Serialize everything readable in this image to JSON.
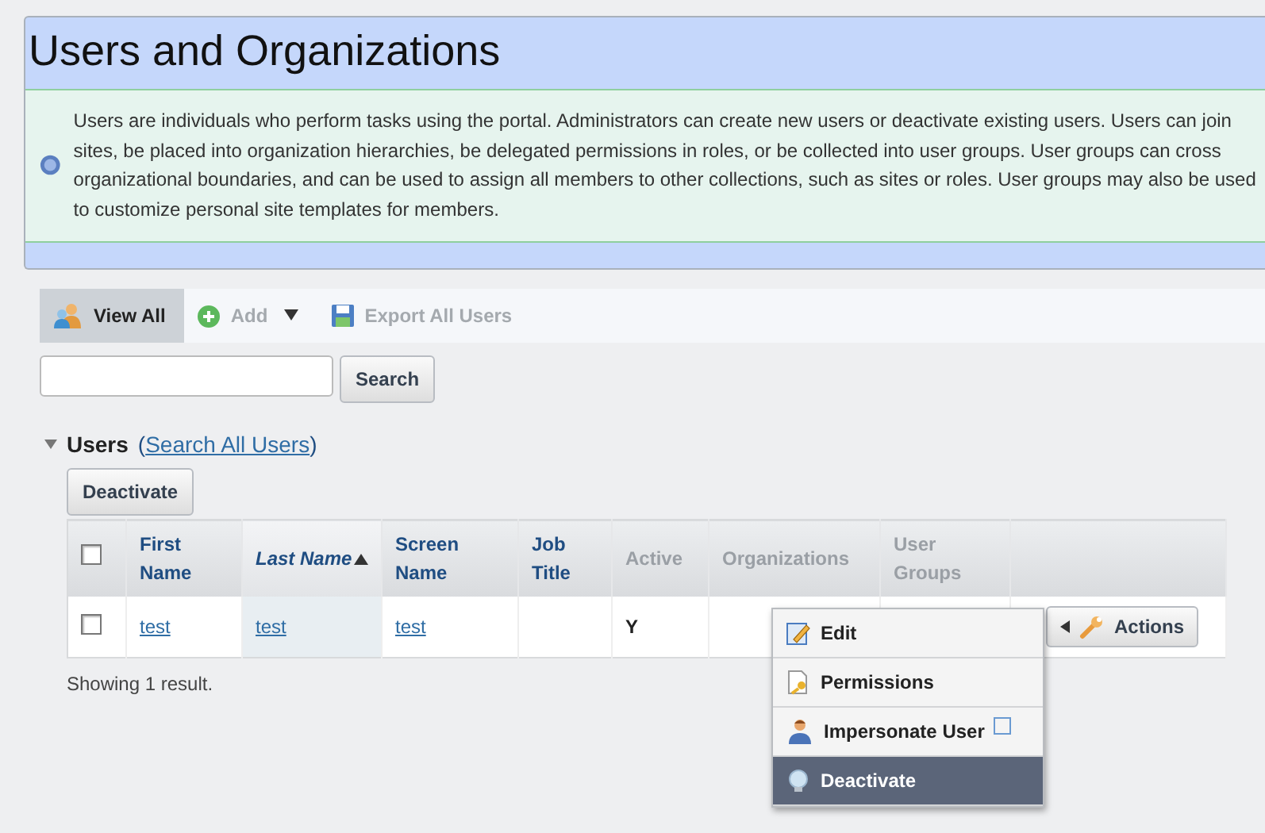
{
  "header": {
    "title": "Users and Organizations",
    "info": "Users are individuals who perform tasks using the portal. Administrators can create new users or deactivate existing users. Users can join sites, be placed into organization hierarchies, be delegated permissions in roles, or be collected into user groups. User groups can cross organizational boundaries, and can be used to assign all members to other collections, such as sites or roles. User groups may also be used to customize personal site templates for members."
  },
  "toolbar": [
    {
      "label": "View All",
      "selected": true,
      "disabled": false,
      "dropdown": false
    },
    {
      "label": "Add",
      "selected": false,
      "disabled": true,
      "dropdown": true
    },
    {
      "label": "Export All Users",
      "selected": false,
      "disabled": true,
      "dropdown": false
    }
  ],
  "search": {
    "button": "Search"
  },
  "section": {
    "title": "Users",
    "link_open": "(",
    "link": "Search All Users",
    "link_close": ")",
    "expanded": true
  },
  "bulk_button": "Deactivate",
  "table": {
    "select_all": {
      "checked": false
    },
    "columns": [
      {
        "label": "First Name",
        "sortable": true,
        "sorted": false
      },
      {
        "label": "Last Name",
        "sortable": true,
        "sorted": true
      },
      {
        "label": "Screen Name",
        "sortable": true,
        "sorted": false
      },
      {
        "label": "Job Title",
        "sortable": true,
        "sorted": false
      },
      {
        "label": "Active",
        "sortable": false,
        "sorted": false
      },
      {
        "label": "Organizations",
        "sortable": false,
        "sorted": false
      },
      {
        "label": "User Groups",
        "sortable": false,
        "sorted": false
      }
    ],
    "rows": [
      {
        "checked": false,
        "cells": [
          "test",
          "test",
          "test",
          "",
          "Y",
          "",
          ""
        ],
        "actions": "Actions"
      }
    ]
  },
  "result_count": "Showing 1 result.",
  "actions_menu": [
    {
      "label": "Edit",
      "selected": false,
      "external": false
    },
    {
      "label": "Permissions",
      "selected": false,
      "external": false
    },
    {
      "label": "Impersonate User",
      "selected": false,
      "external": true
    },
    {
      "label": "Deactivate",
      "selected": true,
      "external": false
    }
  ]
}
